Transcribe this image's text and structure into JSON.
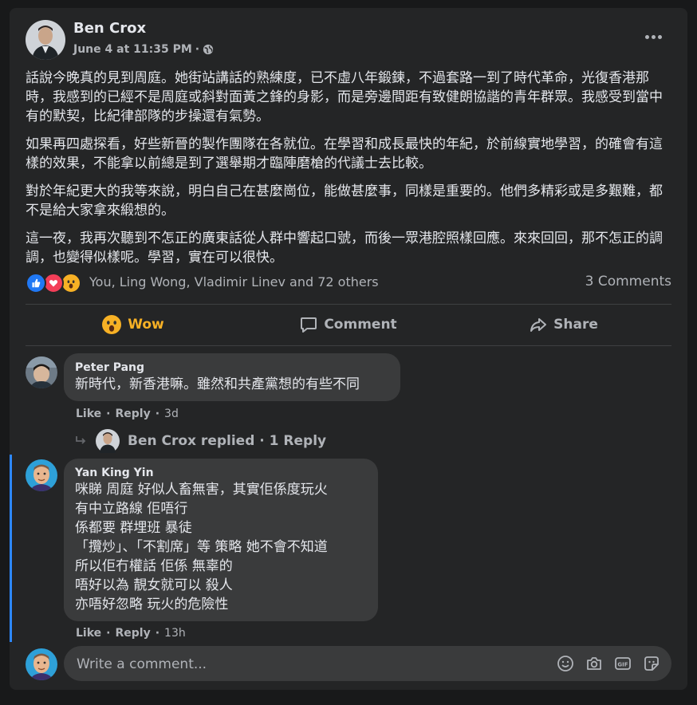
{
  "post": {
    "author": "Ben Crox",
    "date": "June 4 at 11:35 PM",
    "separator": "·",
    "paragraphs": [
      "話說今晚真的見到周庭。她街站講話的熟練度，已不虛八年鍛鍊，不過套路一到了時代革命，光復香港那時，我感到的已經不是周庭或斜對面黃之鋒的身影，而是旁邊間距有致健朗協諧的青年群眾。我感受到當中有的默契，比紀律部隊的步操還有氣勢。",
      "如果再四處探看，好些新晉的製作團隊在各就位。在學習和成長最快的年紀，於前線實地學習，的確會有這樣的效果，不能拿以前總是到了選舉期才臨陣磨槍的代議士去比較。",
      "對於年紀更大的我等來說，明白自己在甚麼崗位，能做甚麼事，同樣是重要的。他們多精彩或是多艱難，都不是給大家拿來緞想的。",
      "這一夜，我再次聽到不怎正的廣東話從人群中響起口號，而後一眾港腔照樣回應。來來回回，那不怎正的調調，也變得似樣呢。學習，實在可以很快。"
    ],
    "reactions_text": "You, Ling Wong, Vladimir Linev and 72 others",
    "comments_count": "3 Comments"
  },
  "actions": {
    "wow": "Wow",
    "comment": "Comment",
    "share": "Share"
  },
  "comments": [
    {
      "name": "Peter Pang",
      "text": "新時代，新香港嘛。雖然和共產黨想的有些不同",
      "like": "Like",
      "reply": "Reply",
      "time": "3d",
      "replied": "Ben Crox replied · 1 Reply"
    },
    {
      "name": "Yan King Yin",
      "text": "咪睇 周庭 好似人畜無害，其實佢係度玩火\n有中立路線 佢唔行\n係都要 群埋班 暴徒\n「攬炒」、「不割席」等 策略 她不會不知道\n所以佢冇權話 佢係 無辜的\n唔好以為 靚女就可以 殺人\n亦唔好忽略 玩火的危險性",
      "like": "Like",
      "reply": "Reply",
      "time": "13h"
    }
  ],
  "write_comment": {
    "placeholder": "Write a comment..."
  },
  "colors": {
    "card": "#242526",
    "bubble": "#3a3b3c",
    "accent": "#2d88ff",
    "wow": "#f7b125"
  }
}
